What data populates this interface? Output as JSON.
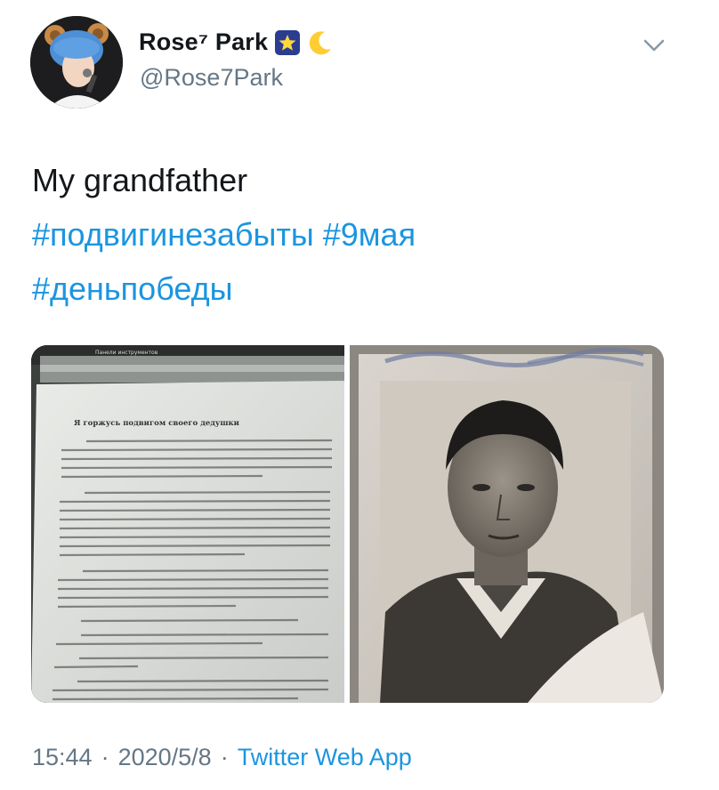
{
  "author": {
    "display_name": "Rose⁷ Park",
    "handle": "@Rose7Park",
    "avatar_icon": "avatar-photo",
    "badges": [
      "star-emoji",
      "crescent-moon-emoji"
    ]
  },
  "tweet": {
    "text": "My grandfather",
    "hashtags": [
      "#подвигинезабыты",
      "#9мая",
      "#деньпобеды"
    ]
  },
  "media": {
    "count": 2,
    "images": [
      {
        "kind": "photo of a printed document",
        "title": "Я горжусь подвигом своего дедушки",
        "toolbar": "Панели инструментов"
      },
      {
        "kind": "old black-and-white portrait photo of a man"
      }
    ]
  },
  "footer": {
    "time": "15:44",
    "separator": "·",
    "date": "2020/5/8",
    "source": "Twitter Web App"
  },
  "colors": {
    "link": "#1b95e0",
    "secondary": "#657786",
    "text": "#14171a"
  }
}
